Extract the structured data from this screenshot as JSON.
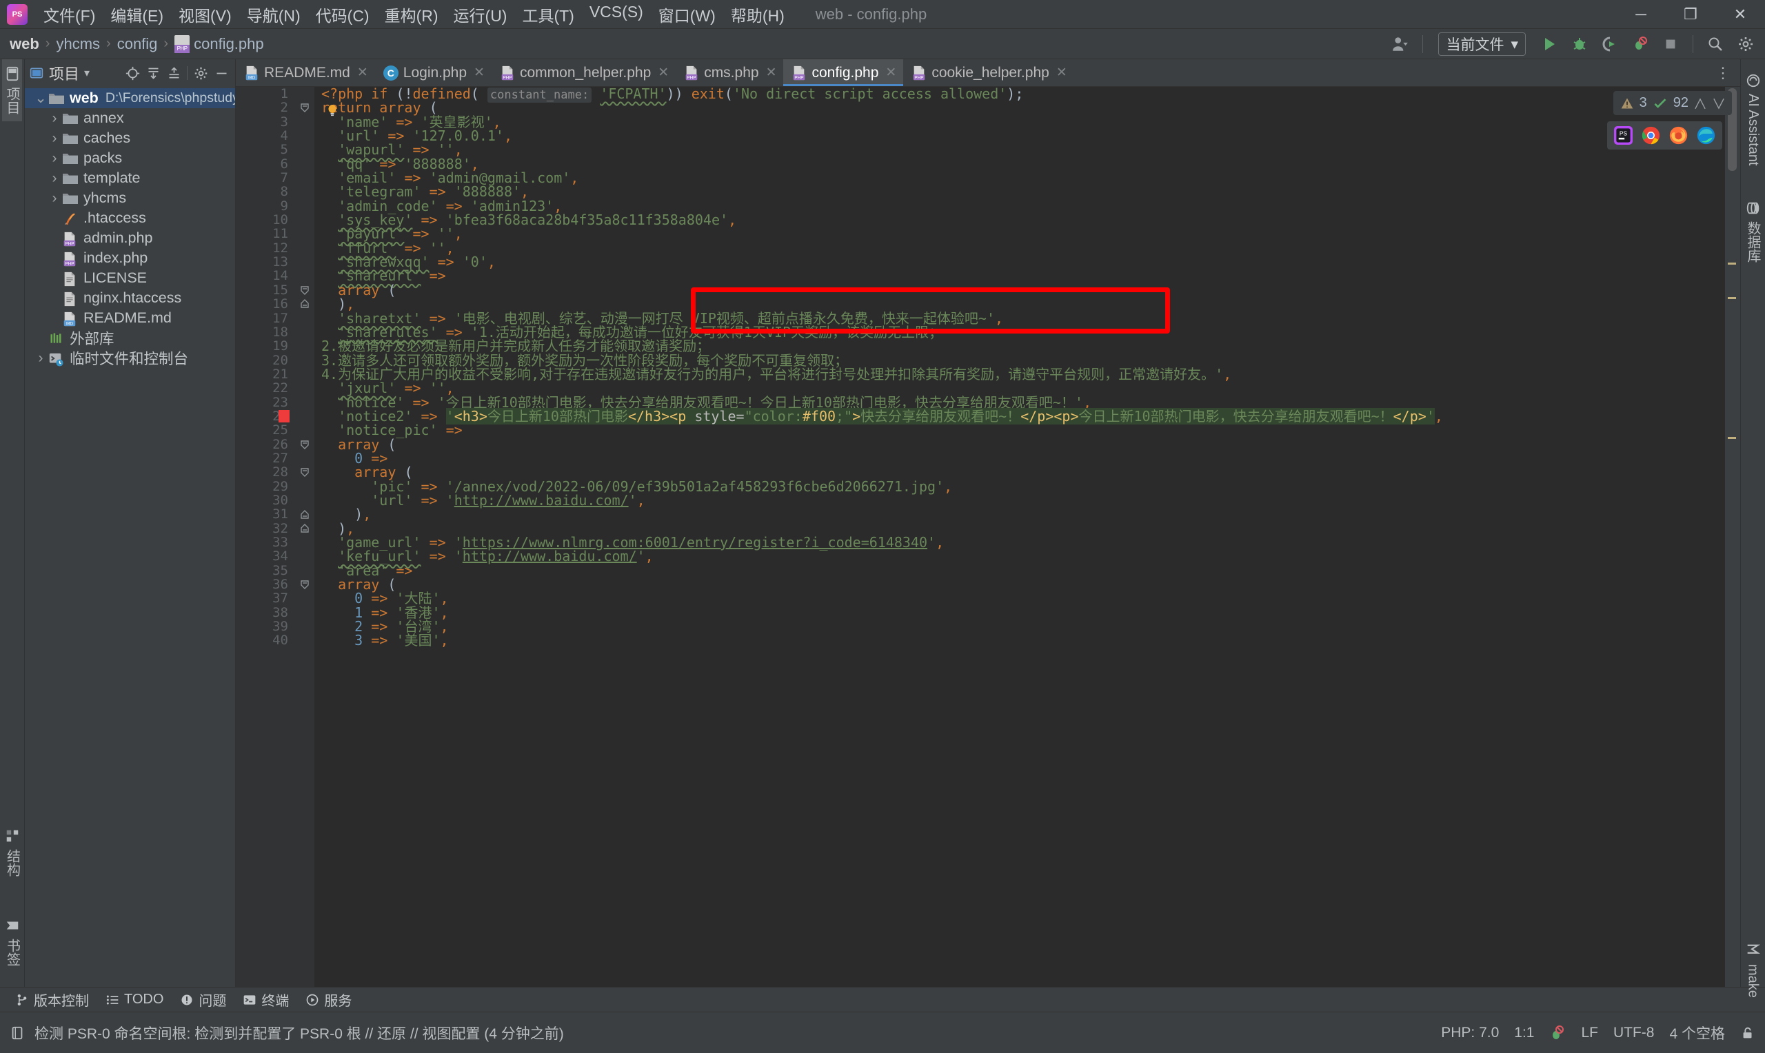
{
  "window": {
    "title": "web - config.php",
    "logo_text": "PS",
    "controls": {
      "minimize": "─",
      "maximize": "❐",
      "close": "✕"
    }
  },
  "menubar": {
    "items": [
      {
        "label": "文件(F)",
        "name": "menu-file"
      },
      {
        "label": "编辑(E)",
        "name": "menu-edit"
      },
      {
        "label": "视图(V)",
        "name": "menu-view"
      },
      {
        "label": "导航(N)",
        "name": "menu-navigate"
      },
      {
        "label": "代码(C)",
        "name": "menu-code"
      },
      {
        "label": "重构(R)",
        "name": "menu-refactor"
      },
      {
        "label": "运行(U)",
        "name": "menu-run"
      },
      {
        "label": "工具(T)",
        "name": "menu-tools"
      },
      {
        "label": "VCS(S)",
        "name": "menu-vcs"
      },
      {
        "label": "窗口(W)",
        "name": "menu-window"
      },
      {
        "label": "帮助(H)",
        "name": "menu-help"
      }
    ]
  },
  "breadcrumb": {
    "items": [
      "web",
      "yhcms",
      "config",
      "config.php"
    ],
    "separator": "›"
  },
  "toolbar": {
    "run_config_label": "当前文件",
    "chevron": "▾",
    "buttons": [
      {
        "name": "run-button",
        "label": "▶"
      },
      {
        "name": "debug-button",
        "label": "debug"
      },
      {
        "name": "run-with-coverage-button",
        "label": "coverage"
      },
      {
        "name": "profile-button",
        "label": "profile"
      },
      {
        "name": "stop-button",
        "label": "■"
      },
      {
        "name": "search-everywhere-button",
        "label": "⌕"
      },
      {
        "name": "settings-button",
        "label": "⚙"
      }
    ]
  },
  "left_rail": {
    "items": [
      {
        "name": "sidebar-item-project",
        "label": "项目",
        "active": true
      },
      {
        "name": "sidebar-item-structure",
        "label": "结构",
        "active": false
      },
      {
        "name": "sidebar-item-bookmarks",
        "label": "书签",
        "active": false
      }
    ]
  },
  "right_rail": {
    "items": [
      {
        "name": "sidebar-item-ai-assistant",
        "label": "AI Assistant"
      },
      {
        "name": "sidebar-item-database",
        "label": "数据库"
      },
      {
        "name": "sidebar-item-maven",
        "label": "make"
      }
    ]
  },
  "project_panel": {
    "title": "项目",
    "header_buttons": [
      {
        "name": "select-opened-file-button",
        "label": "⊕"
      },
      {
        "name": "expand-all-button",
        "label": "⤓"
      },
      {
        "name": "collapse-all-button",
        "label": "⤒"
      },
      {
        "name": "panel-settings-button",
        "label": "⚙"
      },
      {
        "name": "hide-panel-button",
        "label": "─"
      }
    ],
    "tree": [
      {
        "label": "web",
        "path": "D:\\Forensics\\phpstudy_pro\\WWW\\web",
        "icon": "folder-icon",
        "depth": 0,
        "expanded": true,
        "selected": true,
        "name": "tree-node-web"
      },
      {
        "label": "annex",
        "path": "",
        "icon": "folder-icon",
        "depth": 1,
        "expanded": false,
        "selected": false,
        "name": "tree-node-annex"
      },
      {
        "label": "caches",
        "path": "",
        "icon": "folder-icon",
        "depth": 1,
        "expanded": false,
        "selected": false,
        "name": "tree-node-caches"
      },
      {
        "label": "packs",
        "path": "",
        "icon": "folder-icon",
        "depth": 1,
        "expanded": false,
        "selected": false,
        "name": "tree-node-packs"
      },
      {
        "label": "template",
        "path": "",
        "icon": "folder-icon",
        "depth": 1,
        "expanded": false,
        "selected": false,
        "name": "tree-node-template"
      },
      {
        "label": "yhcms",
        "path": "",
        "icon": "folder-icon",
        "depth": 1,
        "expanded": false,
        "selected": false,
        "name": "tree-node-yhcms"
      },
      {
        "label": ".htaccess",
        "path": "",
        "icon": "apache-icon",
        "depth": 1,
        "expanded": null,
        "selected": false,
        "name": "tree-node-htaccess"
      },
      {
        "label": "admin.php",
        "path": "",
        "icon": "php-file-icon",
        "depth": 1,
        "expanded": null,
        "selected": false,
        "name": "tree-node-admin-php"
      },
      {
        "label": "index.php",
        "path": "",
        "icon": "php-file-icon",
        "depth": 1,
        "expanded": null,
        "selected": false,
        "name": "tree-node-index-php"
      },
      {
        "label": "LICENSE",
        "path": "",
        "icon": "text-file-icon",
        "depth": 1,
        "expanded": null,
        "selected": false,
        "name": "tree-node-license"
      },
      {
        "label": "nginx.htaccess",
        "path": "",
        "icon": "text-file-icon",
        "depth": 1,
        "expanded": null,
        "selected": false,
        "name": "tree-node-nginx-htaccess"
      },
      {
        "label": "README.md",
        "path": "",
        "icon": "md-file-icon",
        "depth": 1,
        "expanded": null,
        "selected": false,
        "name": "tree-node-readme-md"
      },
      {
        "label": "外部库",
        "path": "",
        "icon": "library-icon",
        "depth": 0,
        "expanded": null,
        "selected": false,
        "name": "tree-node-external-libraries"
      },
      {
        "label": "临时文件和控制台",
        "path": "",
        "icon": "console-icon",
        "depth": 0,
        "expanded": false,
        "selected": false,
        "name": "tree-node-scratches-consoles"
      }
    ]
  },
  "tabs": [
    {
      "label": "README.md",
      "icon": "md-file-icon",
      "active": false,
      "name": "tab-readme-md"
    },
    {
      "label": "Login.php",
      "icon": "class-icon",
      "active": false,
      "name": "tab-login-php"
    },
    {
      "label": "common_helper.php",
      "icon": "php-file-icon",
      "active": false,
      "name": "tab-common-helper-php"
    },
    {
      "label": "cms.php",
      "icon": "php-file-icon",
      "active": false,
      "name": "tab-cms-php"
    },
    {
      "label": "config.php",
      "icon": "php-file-icon",
      "active": true,
      "name": "tab-config-php"
    },
    {
      "label": "cookie_helper.php",
      "icon": "php-file-icon",
      "active": false,
      "name": "tab-cookie-helper-php"
    }
  ],
  "inspection_widget": {
    "warning_icon": "⚠",
    "warning_count": "3",
    "ok_icon": "✓",
    "ok_count": "92",
    "prev": "∧",
    "next": "∨"
  },
  "browser_popup": {
    "icons": [
      "phpstorm-icon",
      "chrome-icon",
      "firefox-icon",
      "edge-icon"
    ]
  },
  "editor": {
    "language": "php",
    "inlay_hint": "constant_name:",
    "highlight_box": {
      "note": "red annotation rectangle over lines 9-12"
    },
    "lines": [
      {
        "n": 1,
        "html": "<span class='k'>&lt;?php</span> <span class='k'>if</span> <span class='p'>(!</span><span class='k'>defined</span><span class='p'>(</span> <span class='hint'>constant_name:</span> <span class='s sq'>'FCPATH'</span><span class='p'>))</span> <span class='k'>exit</span><span class='p'>(</span><span class='s'>'No direct script access allowed'</span><span class='p'>);</span>"
      },
      {
        "n": 2,
        "html": "<span class='k'>return</span> <span class='k'>array</span> <span class='p'>(</span>"
      },
      {
        "n": 3,
        "html": "  <span class='s'>'name'</span> <span class='c'>=&gt;</span> <span class='s'>'英皇影视'</span><span class='c'>,</span>"
      },
      {
        "n": 4,
        "html": "  <span class='s'>'url'</span> <span class='c'>=&gt;</span> <span class='s'>'127.0.0.1'</span><span class='c'>,</span>"
      },
      {
        "n": 5,
        "html": "  <span class='s sq'>'wapurl'</span> <span class='c'>=&gt;</span> <span class='s'>''</span><span class='c'>,</span>"
      },
      {
        "n": 6,
        "html": "  <span class='s'>'qq'</span> <span class='c'>=&gt;</span> <span class='s'>'888888'</span><span class='c'>,</span>"
      },
      {
        "n": 7,
        "html": "  <span class='s'>'email'</span> <span class='c'>=&gt;</span> <span class='s'>'admin@gmail.com'</span><span class='c'>,</span>"
      },
      {
        "n": 8,
        "html": "  <span class='s'>'telegram'</span> <span class='c'>=&gt;</span> <span class='s'>'888888'</span><span class='c'>,</span>"
      },
      {
        "n": 9,
        "html": "  <span class='s'>'admin_code'</span> <span class='c'>=&gt;</span> <span class='s'>'admin123'</span><span class='c'>,</span>"
      },
      {
        "n": 10,
        "html": "  <span class='s sq'>'sys_key'</span> <span class='c'>=&gt;</span> <span class='s'>'bfea3f68aca28b4f35a8c11f358a804e'</span><span class='c'>,</span>"
      },
      {
        "n": 11,
        "html": "  <span class='s sq'>'payurl'</span> <span class='c'>=&gt;</span> <span class='s'>''</span><span class='c'>,</span>"
      },
      {
        "n": 12,
        "html": "  <span class='s sq'>'ffurl'</span> <span class='c'>=&gt;</span> <span class='s'>''</span><span class='c'>,</span>"
      },
      {
        "n": 13,
        "html": "  <span class='s sq'>'sharewxqq'</span> <span class='c'>=&gt;</span> <span class='s'>'0'</span><span class='c'>,</span>"
      },
      {
        "n": 14,
        "html": "  <span class='s sq'>'shareurl'</span> <span class='c'>=&gt;</span>"
      },
      {
        "n": 15,
        "html": "  <span class='k'>array</span> <span class='p'>(</span>"
      },
      {
        "n": 16,
        "html": "  <span class='p'>)</span><span class='c'>,</span>"
      },
      {
        "n": 17,
        "html": "  <span class='s sq'>'sharetxt'</span> <span class='c'>=&gt;</span> <span class='s'>'电影、电视剧、综艺、动漫一网打尽 VIP视频、超前点播永久免费，快来一起体验吧~'</span><span class='c'>,</span>"
      },
      {
        "n": 18,
        "html": "  <span class='s sq'>'sharerules'</span> <span class='c'>=&gt;</span> <span class='s'>'1.活动开始起，每成功邀请一位好友可获得1天VIP天奖励，该奖励无上限；</span>"
      },
      {
        "n": 19,
        "html": "<span class='s'>2.被邀请好友必须是新用户并完成新人任务才能领取邀请奖励；</span>"
      },
      {
        "n": 20,
        "html": "<span class='s'>3.邀请多人还可领取额外奖励，额外奖励为一次性阶段奖励，每个奖励不可重复领取；</span>"
      },
      {
        "n": 21,
        "html": "<span class='s'>4.为保证广大用户的收益不受影响,对于存在违规邀请好友行为的用户，平台将进行封号处理并扣除其所有奖励，请遵守平台规则，正常邀请好友。'</span><span class='c'>,</span>"
      },
      {
        "n": 22,
        "html": "  <span class='s sq'>'jxurl'</span> <span class='c'>=&gt;</span> <span class='s'>''</span><span class='c'>,</span>"
      },
      {
        "n": 23,
        "html": "  <span class='s'>'notice'</span> <span class='c'>=&gt;</span> <span class='s'>'今日上新10部热门电影，快去分享给朋友观看吧~！今日上新10部热门电影，快去分享给朋友观看吧~！'</span><span class='c'>,</span>"
      },
      {
        "n": 24,
        "html": "  <span class='s'>'notice2'</span> <span class='c'>=&gt;</span> <span class='hl-sel'><span class='s'>'</span><span class='tagc'>&lt;h3&gt;</span><span class='s'>今日上新10部热门电影</span><span class='tagc'>&lt;/h3&gt;&lt;p</span> <span class='attr'>style=</span><span class='s'>\"color:</span><span class='tagc'>#f00</span><span class='s'>;\"</span><span class='tagc'>&gt;</span><span class='s'>快去分享给朋友观看吧~！</span><span class='tagc'>&lt;/p&gt;&lt;p&gt;</span><span class='s'>今日上新10部热门电影，快去分享给朋友观看吧~！</span><span class='tagc'>&lt;/p&gt;</span><span class='s'>'</span></span><span class='c'>,</span>"
      },
      {
        "n": 25,
        "html": "  <span class='s'>'notice_pic'</span> <span class='c'>=&gt;</span>"
      },
      {
        "n": 26,
        "html": "  <span class='k'>array</span> <span class='p'>(</span>"
      },
      {
        "n": 27,
        "html": "    <span class='n'>0</span> <span class='c'>=&gt;</span>"
      },
      {
        "n": 28,
        "html": "    <span class='k'>array</span> <span class='p'>(</span>"
      },
      {
        "n": 29,
        "html": "      <span class='s'>'pic'</span> <span class='c'>=&gt;</span> <span class='s'>'/annex/vod/2022-06/09/ef39b501a2af458293f6cbe6d2066271.jpg'</span><span class='c'>,</span>"
      },
      {
        "n": 30,
        "html": "      <span class='s'>'url'</span> <span class='c'>=&gt;</span> <span class='s'>'</span><span class='s lnk'>http://www.baidu.com/</span><span class='s'>'</span><span class='c'>,</span>"
      },
      {
        "n": 31,
        "html": "    <span class='p'>)</span><span class='c'>,</span>"
      },
      {
        "n": 32,
        "html": "  <span class='p'>)</span><span class='c'>,</span>"
      },
      {
        "n": 33,
        "html": "  <span class='s'>'game_url'</span> <span class='c'>=&gt;</span> <span class='s'>'</span><span class='s lnk'>https://www.nlmrg.com:6001/entry/register?i_code=6148340</span><span class='s'>'</span><span class='c'>,</span>"
      },
      {
        "n": 34,
        "html": "  <span class='s sq'>'kefu_url'</span> <span class='c'>=&gt;</span> <span class='s'>'</span><span class='s lnk'>http://www.baidu.com/</span><span class='s'>'</span><span class='c'>,</span>"
      },
      {
        "n": 35,
        "html": "  <span class='s'>'area'</span> <span class='c'>=&gt;</span>"
      },
      {
        "n": 36,
        "html": "  <span class='k'>array</span> <span class='p'>(</span>"
      },
      {
        "n": 37,
        "html": "    <span class='n'>0</span> <span class='c'>=&gt;</span> <span class='s'>'大陆'</span><span class='c'>,</span>"
      },
      {
        "n": 38,
        "html": "    <span class='n'>1</span> <span class='c'>=&gt;</span> <span class='s'>'香港'</span><span class='c'>,</span>"
      },
      {
        "n": 39,
        "html": "    <span class='n'>2</span> <span class='c'>=&gt;</span> <span class='s'>'台湾'</span><span class='c'>,</span>"
      },
      {
        "n": 40,
        "html": "    <span class='n'>3</span> <span class='c'>=&gt;</span> <span class='s'>'美国'</span><span class='c'>,"
      }
    ]
  },
  "tool_window_bar": {
    "items": [
      {
        "label": "版本控制",
        "icon": "vcs-icon",
        "name": "toolwindow-version-control"
      },
      {
        "label": "TODO",
        "icon": "todo-icon",
        "name": "toolwindow-todo"
      },
      {
        "label": "问题",
        "icon": "problems-icon",
        "name": "toolwindow-problems"
      },
      {
        "label": "终端",
        "icon": "terminal-icon",
        "name": "toolwindow-terminal"
      },
      {
        "label": "服务",
        "icon": "services-icon",
        "name": "toolwindow-services"
      }
    ]
  },
  "statusbar": {
    "message": "检测 PSR-0 命名空间根: 检测到并配置了 PSR-0 根 // 还原 // 视图配置 (4 分钟之前)",
    "php_version": "PHP: 7.0",
    "caret_position": "1:1",
    "line_separator": "LF",
    "encoding": "UTF-8",
    "indent": "4 个空格",
    "lock_icon": "⚿"
  }
}
